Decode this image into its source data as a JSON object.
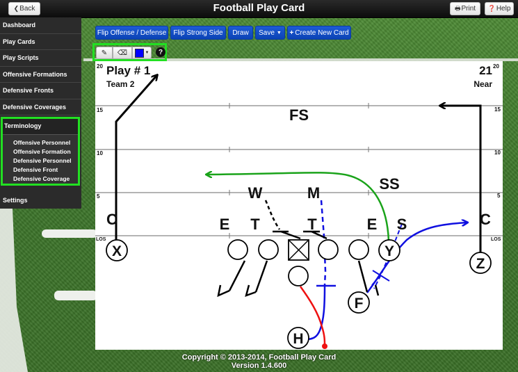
{
  "header": {
    "title": "Football Play Card",
    "back_label": "Back",
    "print_label": "Print",
    "help_label": "Help"
  },
  "sidebar": {
    "items": [
      {
        "label": "Dashboard"
      },
      {
        "label": "Play Cards"
      },
      {
        "label": "Play Scripts"
      },
      {
        "label": "Offensive Formations"
      },
      {
        "label": "Defensive Fronts"
      },
      {
        "label": "Defensive Coverages"
      }
    ],
    "terminology": {
      "label": "Terminology",
      "subitems": [
        {
          "label": "Offensive Personnel"
        },
        {
          "label": "Offensive Formation"
        },
        {
          "label": "Defensive Personnel"
        },
        {
          "label": "Defensive Front"
        },
        {
          "label": "Defensive Coverage"
        }
      ]
    },
    "settings_label": "Settings"
  },
  "toolbar": {
    "flip_offense_defense": "Flip Offense / Defense",
    "flip_strong_side": "Flip Strong Side",
    "draw": "Draw",
    "save": "Save",
    "create_new_card": "Create New Card",
    "pen_color": "#0000ff",
    "help_glyph": "?"
  },
  "card": {
    "play_title": "Play # 1",
    "team": "Team 2",
    "play_number": "21",
    "hash": "Near",
    "yard_labels": {
      "y20": "20",
      "y15": "15",
      "y10": "10",
      "y5": "5",
      "los": "LOS"
    },
    "offense": [
      {
        "label": "X"
      },
      {
        "label": "Y"
      },
      {
        "label": "Z"
      },
      {
        "label": "F"
      },
      {
        "label": "H"
      }
    ],
    "defense": [
      {
        "label": "FS"
      },
      {
        "label": "SS"
      },
      {
        "label": "W"
      },
      {
        "label": "M"
      },
      {
        "label": "E"
      },
      {
        "label": "T"
      },
      {
        "label": "T"
      },
      {
        "label": "E"
      },
      {
        "label": "S"
      },
      {
        "label": "C"
      },
      {
        "label": "C"
      }
    ],
    "route_colors": {
      "black": "#000000",
      "green": "#1aa31a",
      "blue": "#1010e0",
      "red": "#ee1111"
    }
  },
  "footer": {
    "copyright": "Copyright © 2013-2014, Football Play Card",
    "version": "Version 1.4.600"
  }
}
